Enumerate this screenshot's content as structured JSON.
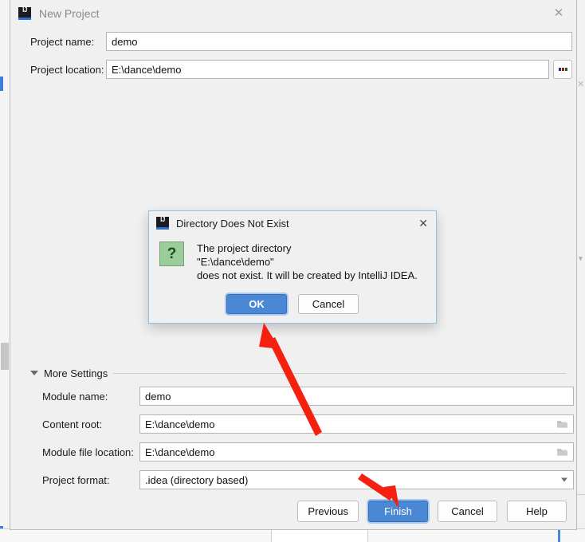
{
  "background": {
    "left_strip_name": "ide-background-left",
    "right_strip_name": "ide-background-right",
    "close_glyph": "✕",
    "chevron_glyph": "▼"
  },
  "wizard": {
    "title": "New Project",
    "app_icon": "intellij-idea-icon",
    "close_glyph": "✕",
    "fields": [
      {
        "label": "Project name:",
        "value": "demo",
        "name": "project-name"
      },
      {
        "label": "Project location:",
        "value": "E:\\dance\\demo",
        "name": "project-location"
      }
    ],
    "browse_button_label": "...",
    "more_settings": {
      "label": "More Settings",
      "expanded": true,
      "fields": [
        {
          "label": "Module name:",
          "value": "demo",
          "name": "module-name",
          "has_folder_icon": false
        },
        {
          "label": "Content root:",
          "value": "E:\\dance\\demo",
          "name": "content-root",
          "has_folder_icon": true
        },
        {
          "label": "Module file location:",
          "value": "E:\\dance\\demo",
          "name": "module-file-location",
          "has_folder_icon": true
        },
        {
          "label": "Project format:",
          "value": ".idea (directory based)",
          "name": "project-format",
          "has_folder_icon": false
        }
      ]
    },
    "buttons": [
      {
        "label": "Previous",
        "primary": false,
        "name": "previous-button"
      },
      {
        "label": "Finish",
        "primary": true,
        "name": "finish-button"
      },
      {
        "label": "Cancel",
        "primary": false,
        "name": "cancel-button"
      },
      {
        "label": "Help",
        "primary": false,
        "name": "help-button"
      }
    ]
  },
  "modal": {
    "title": "Directory Does Not Exist",
    "app_icon": "intellij-idea-icon",
    "close_glyph": "✕",
    "icon_glyph": "?",
    "message_lines": [
      "The project directory",
      "\"E:\\dance\\demo\"",
      "does not exist. It will be created by IntelliJ IDEA."
    ],
    "buttons": [
      {
        "label": "OK",
        "primary": true,
        "name": "ok-button"
      },
      {
        "label": "Cancel",
        "primary": false,
        "name": "modal-cancel-button"
      }
    ]
  },
  "annotations": {
    "color": "#f5200f",
    "arrows": [
      {
        "name": "arrow-to-ok-button",
        "target": "ok-button"
      },
      {
        "name": "arrow-to-finish-button",
        "target": "finish-button"
      }
    ]
  },
  "colors": {
    "accent": "#4a87d4",
    "dialog_bg": "#f0f0f0",
    "modal_border": "#8fc2e0",
    "annotation_red": "#f5200f",
    "question_icon_green": "#9ccb9c"
  }
}
